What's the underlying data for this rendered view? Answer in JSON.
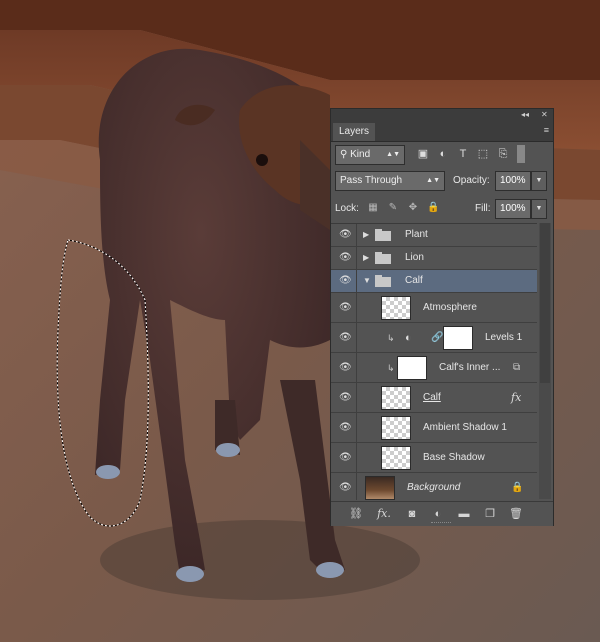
{
  "panel": {
    "title_tab": "Layers",
    "window_controls": {
      "collapse": "◂◂",
      "close": "✕"
    },
    "menu_icon": "≡",
    "filter": {
      "value": "Kind",
      "icons": [
        "search-icon",
        "image-filter-icon",
        "adjustment-filter-icon",
        "type-filter-icon",
        "shape-filter-icon",
        "smart-object-filter-icon",
        "filter-toggle-icon"
      ]
    },
    "blend_mode": "Pass Through",
    "opacity_label": "Opacity:",
    "opacity_value": "100%",
    "lock_label": "Lock:",
    "fill_label": "Fill:",
    "fill_value": "100%"
  },
  "layers": [
    {
      "name": "Plant",
      "type": "group",
      "expanded": false
    },
    {
      "name": "Lion",
      "type": "group",
      "expanded": false
    },
    {
      "name": "Calf",
      "type": "group",
      "expanded": true,
      "selected": true
    },
    {
      "name": "Atmosphere",
      "type": "pixel",
      "clipped": false
    },
    {
      "name": "Levels 1",
      "type": "adjustment",
      "clipped": true
    },
    {
      "name": "Calf's Inner ...",
      "type": "smart",
      "clipped": true
    },
    {
      "name": "Calf",
      "type": "pixel",
      "fx": true
    },
    {
      "name": "Ambient Shadow 1",
      "type": "pixel"
    },
    {
      "name": "Base Shadow",
      "type": "pixel"
    },
    {
      "name": "Background",
      "type": "background",
      "locked": true
    }
  ],
  "bottom_icons": [
    "link-layers-icon",
    "fx-icon",
    "add-mask-icon",
    "new-adjustment-icon",
    "new-group-icon",
    "new-layer-icon",
    "delete-layer-icon"
  ],
  "colors": {
    "panel_bg": "#535353",
    "selected_row": "#5c6b80",
    "floor": "#7a5a48"
  }
}
